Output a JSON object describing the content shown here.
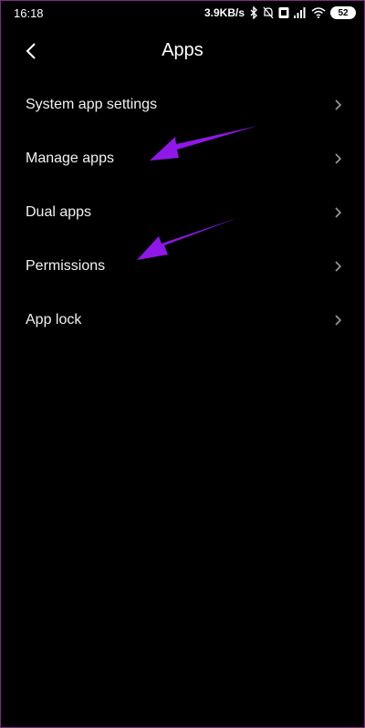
{
  "status_bar": {
    "time": "16:18",
    "network_speed": "3.9KB/s",
    "battery_level": "52",
    "icons": [
      "bluetooth-icon",
      "mute-icon",
      "volte-icon",
      "signal-icon",
      "wifi-icon",
      "battery-icon"
    ]
  },
  "header": {
    "title": "Apps",
    "back_icon": "chevron-left-icon"
  },
  "menu": {
    "items": [
      {
        "label": "System app settings"
      },
      {
        "label": "Manage apps"
      },
      {
        "label": "Dual apps"
      },
      {
        "label": "Permissions"
      },
      {
        "label": "App lock"
      }
    ]
  },
  "colors": {
    "background": "#000000",
    "text": "#f2f2f2",
    "annotation_arrow": "#8f18e8",
    "chevron": "#9a9a9a"
  }
}
